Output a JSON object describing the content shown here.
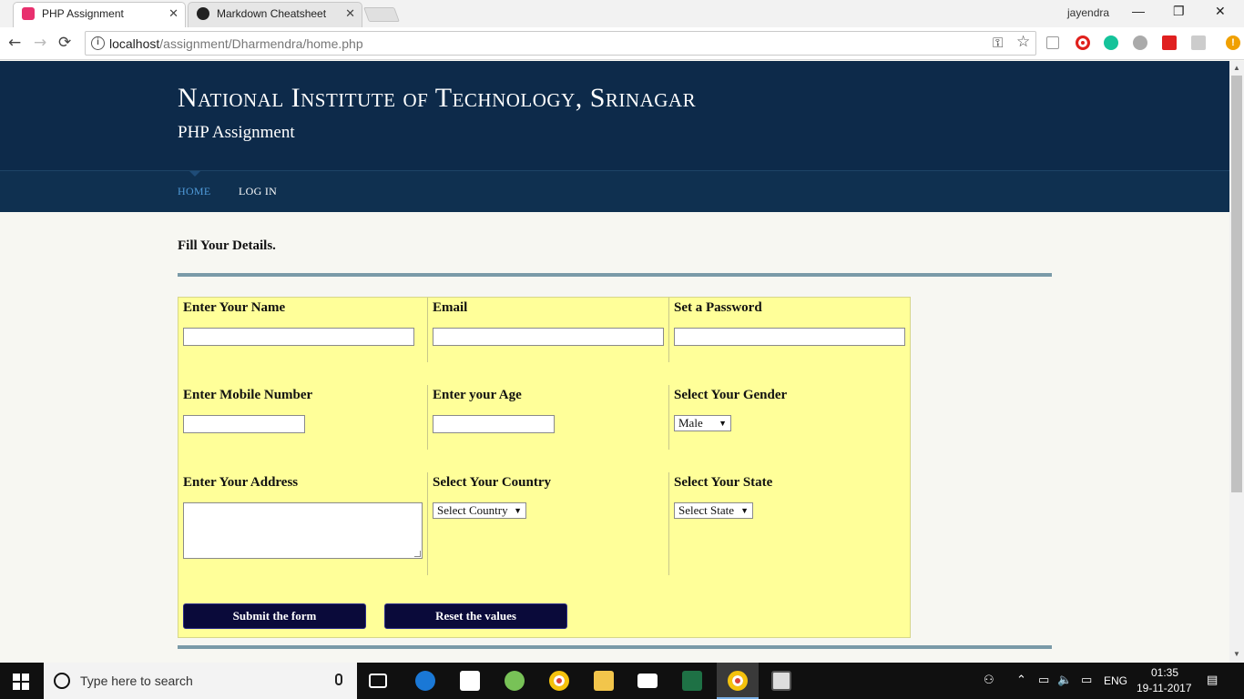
{
  "browser": {
    "tabs": [
      {
        "title": "PHP Assignment",
        "active": true
      },
      {
        "title": "Markdown Cheatsheet · /",
        "active": false
      }
    ],
    "profile": "jayendra",
    "url_host": "localhost",
    "url_path": "/assignment/Dharmendra/home.php",
    "tab_close_glyph": "✕",
    "window_controls": {
      "minimize": "—",
      "restore": "❐",
      "close": "✕"
    },
    "nav_glyphs": {
      "back": "←",
      "forward": "→",
      "reload": "⟳"
    },
    "omnibox_glyphs": {
      "info": "i",
      "key": "⚿",
      "star": "☆"
    },
    "menu_glyph": "!",
    "extension_icons": [
      "cast-icon",
      "opera-icon",
      "grammarly-icon",
      "globe-icon",
      "pdf-icon",
      "stats-icon"
    ],
    "colors": {
      "tab_favicon": "#e8306e",
      "github_favicon": "#222222"
    }
  },
  "site": {
    "title": "National Institute of Technology, Srinagar",
    "subtitle": "PHP Assignment",
    "nav": [
      {
        "label": "Home",
        "active": true
      },
      {
        "label": "Log In",
        "active": false
      }
    ],
    "colors": {
      "header_bg": "#0d2a4a",
      "nav_active": "#4f9ad8"
    }
  },
  "form": {
    "heading": "Fill Your Details.",
    "fields": {
      "name": {
        "label": "Enter Your Name",
        "value": ""
      },
      "email": {
        "label": "Email",
        "value": ""
      },
      "password": {
        "label": "Set a Password",
        "value": ""
      },
      "mobile": {
        "label": "Enter Mobile Number",
        "value": ""
      },
      "age": {
        "label": "Enter your Age",
        "value": ""
      },
      "gender": {
        "label": "Select Your Gender",
        "selected": "Male"
      },
      "address": {
        "label": "Enter Your Address",
        "value": ""
      },
      "country": {
        "label": "Select Your Country",
        "selected": "Select Country"
      },
      "state": {
        "label": "Select Your State",
        "selected": "Select State"
      }
    },
    "select_arrow": "▼",
    "buttons": {
      "submit": "Submit the form",
      "reset": "Reset the values"
    },
    "colors": {
      "form_bg": "#ffff99",
      "button_bg": "#0a0a3a",
      "rule": "#7a9aa8"
    }
  },
  "scrollbar": {
    "up": "▲",
    "down": "▼"
  },
  "taskbar": {
    "search_placeholder": "Type here to search",
    "pinned_icons": [
      "task-view-icon",
      "edge-icon",
      "store-icon",
      "android-studio-icon",
      "chrome-icon",
      "file-explorer-icon",
      "mail-icon",
      "excel-icon",
      "chrome-active-icon",
      "app-icon"
    ],
    "tray_glyphs": {
      "people": "⚇",
      "chevron": "⌃",
      "battery": "▭",
      "volume": "🔈",
      "network": "▭",
      "notifications": "▤"
    },
    "language": "ENG",
    "time": "01:35",
    "date": "19-11-2017"
  }
}
